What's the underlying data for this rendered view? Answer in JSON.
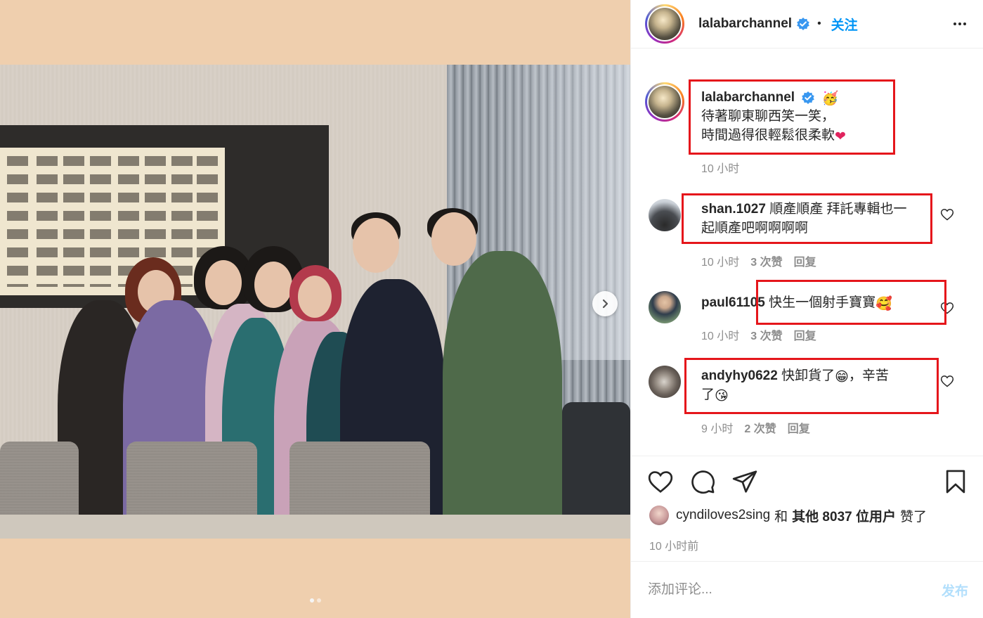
{
  "post": {
    "username": "lalabarchannel",
    "separator": "•",
    "follow_label": "关注",
    "more_icon": "more-horizontal-icon"
  },
  "caption": {
    "username": "lalabarchannel",
    "emoji_1": "🥳",
    "line_1": "待著聊東聊西笑一笑，",
    "line_2": "時間過得很輕鬆很柔軟",
    "emoji_2": "❤",
    "time": "10 小时"
  },
  "comments": [
    {
      "username": "shan.1027",
      "text_1": "順產順產 拜託專輯也一",
      "text_2": "起順產吧啊啊啊啊",
      "time": "10 小时",
      "likes": "3 次赞",
      "reply": "回复"
    },
    {
      "username": "paul61105",
      "text_1": "快生一個射手寶寶",
      "emoji": "🥰",
      "time": "10 小时",
      "likes": "3 次赞",
      "reply": "回复"
    },
    {
      "username": "andyhy0622",
      "text_1": "快卸貨了",
      "emoji_a": "😁",
      "text_1b": "，辛苦",
      "text_2": "了",
      "emoji_b": "😘",
      "time": "9 小时",
      "likes": "2 次赞",
      "reply": "回复"
    }
  ],
  "likes": {
    "liker": "cyndiloves2sing",
    "and": "和",
    "others": "其他 8037 位用户",
    "suffix": "赞了",
    "timestamp": "10 小时前"
  },
  "composer": {
    "placeholder": "添加评论...",
    "post_label": "发布"
  },
  "carousel": {
    "slide": 1,
    "total": 2
  },
  "colors": {
    "accent": "#0095f6",
    "annotation": "#e5161b",
    "muted": "#8e8e8e"
  }
}
